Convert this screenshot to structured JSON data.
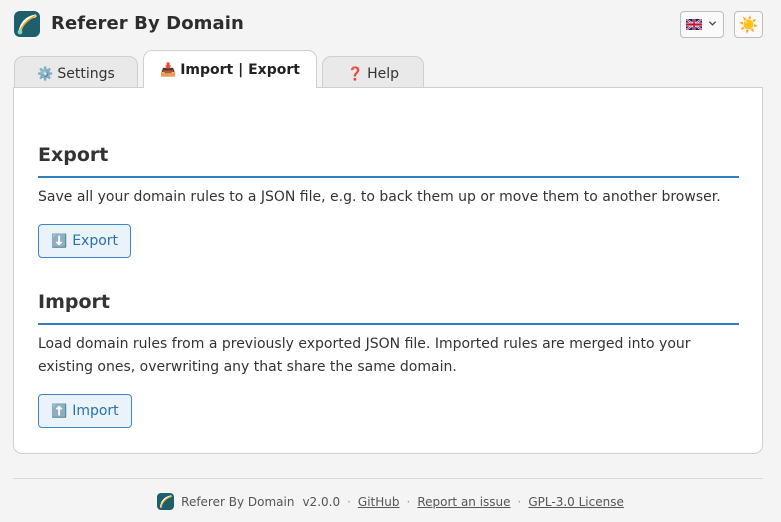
{
  "app": {
    "title": "Referer By Domain"
  },
  "header": {
    "language": {
      "selected": "English",
      "icon": "uk-flag-icon"
    },
    "theme_toggle": {
      "icon": "sun-icon",
      "glyph": "☀️"
    }
  },
  "tabs": [
    {
      "emoji": "⚙️",
      "label": "Settings",
      "active": false
    },
    {
      "emoji": "📥",
      "label": "Import | Export",
      "active": true
    },
    {
      "emoji": "❓",
      "label": "Help",
      "active": false
    }
  ],
  "export": {
    "title": "Export",
    "description": "Save all your domain rules to a JSON file, e.g. to back them up or move them to another browser.",
    "button_emoji": "⬇️",
    "button_label": "Export"
  },
  "import": {
    "title": "Import",
    "description": "Load domain rules from a previously exported JSON file. Imported rules are merged into your existing ones, overwriting any that share the same domain.",
    "button_emoji": "⬆️",
    "button_label": "Import"
  },
  "footer": {
    "name": "Referer By Domain",
    "version": "v2.0.0",
    "separator": "·",
    "links": [
      "GitHub",
      "Report an issue",
      "GPL-3.0 License"
    ]
  },
  "colors": {
    "accent": "#2f7fc1",
    "button_bg": "#eaf2fa",
    "logo_bg": "#1f5f6b"
  }
}
